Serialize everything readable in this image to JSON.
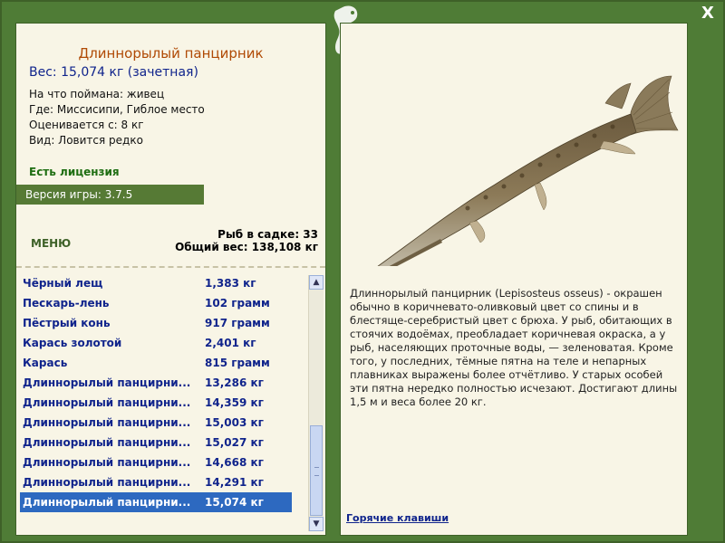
{
  "window": {
    "close_label": "X"
  },
  "fish": {
    "title": "Длиннорылый панцирник",
    "weight": "Вес: 15,074 кг (зачетная)",
    "caught_with": "На что поймана: живец",
    "location": "Где: Миссисипи, Гиблое место",
    "rated_from": "Оценивается с: 8 кг",
    "kind": "Вид: Ловится редко"
  },
  "license": "Есть лицензия",
  "version": "Версия игры: 3.7.5",
  "menu_label": "МЕНЮ",
  "cage": {
    "count": "Рыб в садке: 33",
    "total_weight": "Общий вес: 138,108 кг"
  },
  "catch_list": [
    {
      "name": "Чёрный лещ",
      "value": "1,383 кг"
    },
    {
      "name": "Пескарь-лень",
      "value": "102 грамм"
    },
    {
      "name": "Пёстрый конь",
      "value": "917 грамм"
    },
    {
      "name": "Карась золотой",
      "value": "2,401 кг"
    },
    {
      "name": "Карась",
      "value": "815 грамм"
    },
    {
      "name": "Длиннорылый панцирни...",
      "value": "13,286 кг"
    },
    {
      "name": "Длиннорылый панцирни...",
      "value": "14,359 кг"
    },
    {
      "name": "Длиннорылый панцирни...",
      "value": "15,003 кг"
    },
    {
      "name": "Длиннорылый панцирни...",
      "value": "15,027 кг"
    },
    {
      "name": "Длиннорылый панцирни...",
      "value": "14,668 кг"
    },
    {
      "name": "Длиннорылый панцирни...",
      "value": "14,291 кг"
    },
    {
      "name": "Длиннорылый панцирни...",
      "value": "15,074 кг"
    }
  ],
  "selected_index": 11,
  "description": "Длиннорылый панцирник (Lepisosteus osseus) - окрашен обычно в коричневато-оливковый цвет со спины и в блестяще-серебристый цвет с брюха. У рыб, обитающих в стоячих водоёмах, преобладает коричневая окраска, а у рыб, населяющих проточные воды, — зеленоватая. Кроме того, у последних, тёмные пятна на теле и непарных плавниках выражены более отчётливо. У старых особей эти пятна нередко полностью исчезают. Достигают длины 1,5 м и веса более 20 кг.",
  "hotkeys_label": "Горячие клавиши",
  "colors": {
    "frame": "#4f7c36",
    "panel": "#f8f5e6",
    "title": "#b04a05",
    "link": "#10248c",
    "selection": "#2d69c0"
  }
}
